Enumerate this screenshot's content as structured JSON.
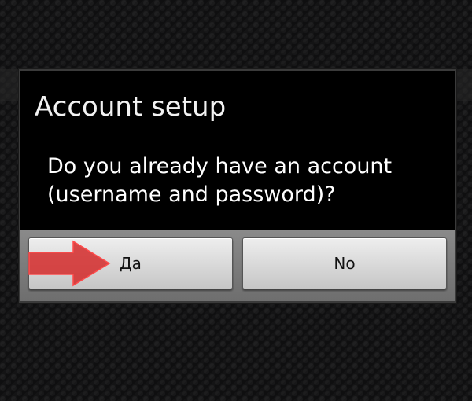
{
  "dialog": {
    "title": "Account setup",
    "message": "Do you already have an account (username and password)?",
    "buttons": {
      "yes_label": "Да",
      "no_label": "No"
    }
  },
  "annotation": {
    "icon": "arrow-right-icon",
    "color": "#d42a2a"
  }
}
